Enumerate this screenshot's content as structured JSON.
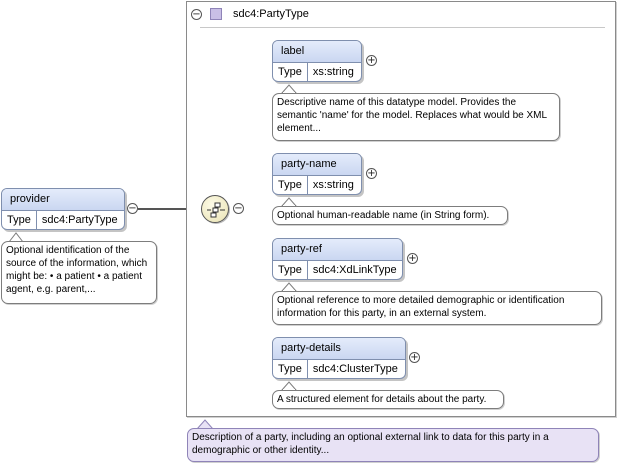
{
  "root": {
    "name": "provider",
    "type_key": "Type",
    "type_value": "sdc4:PartyType",
    "doc": "Optional identification of the source of the information, which might be: • a patient • a patient agent, e.g. parent,..."
  },
  "party_type": {
    "title": "sdc4:PartyType",
    "doc": "Description of a party, including an optional external link to data for this party in a demographic or other identity..."
  },
  "children": [
    {
      "name": "label",
      "type_key": "Type",
      "type_value": "xs:string",
      "doc": "Descriptive name of this datatype model. Provides the semantic 'name' for the model. Replaces what would be XML element..."
    },
    {
      "name": "party-name",
      "type_key": "Type",
      "type_value": "xs:string",
      "doc": "Optional human-readable name (in String form)."
    },
    {
      "name": "party-ref",
      "type_key": "Type",
      "type_value": "sdc4:XdLinkType",
      "doc": "Optional reference to more detailed demographic or identification information for this party, in an external system."
    },
    {
      "name": "party-details",
      "type_key": "Type",
      "type_value": "sdc4:ClusterType",
      "doc": "A structured element for details about the party."
    }
  ],
  "icons": {
    "collapse": "−",
    "expand": "+",
    "compositor": "sequence-icon"
  },
  "colors": {
    "element_header": "#cad7f1",
    "type_marker": "#c9bfe6",
    "type_doc_background": "#e8e2f5"
  }
}
